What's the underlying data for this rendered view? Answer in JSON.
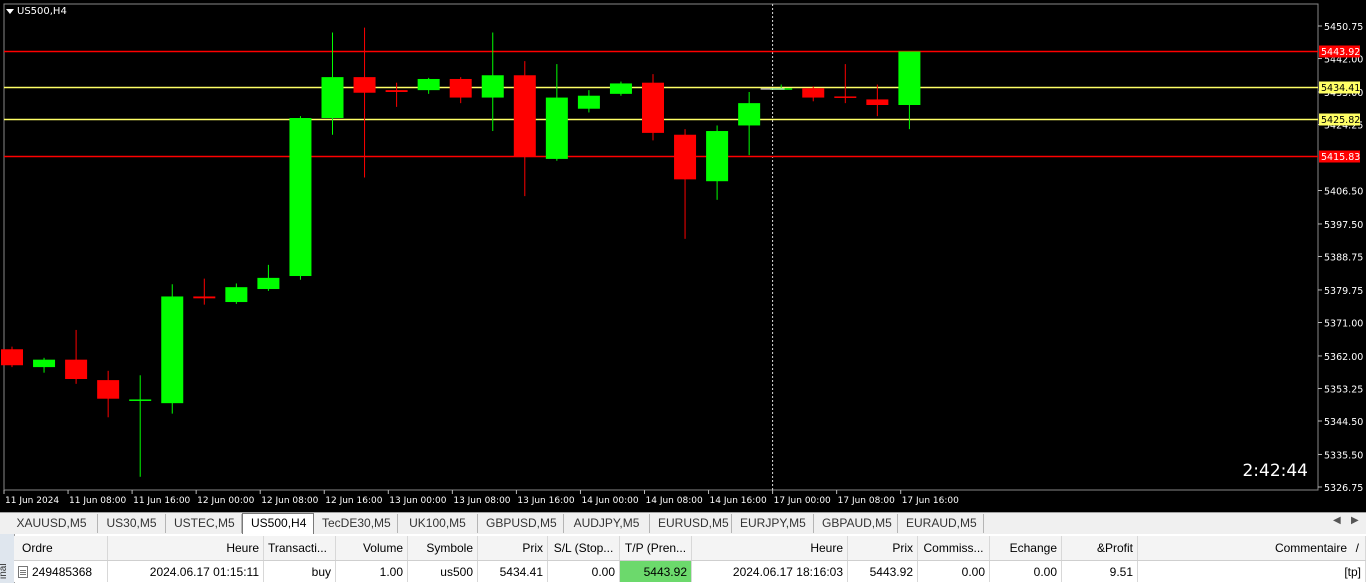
{
  "chart": {
    "symbol_label": "US500,H4",
    "countdown": "2:42:44",
    "colors": {
      "bg": "#000000",
      "bull": "#00ff00",
      "bear": "#ff0000",
      "wick_bull": "#00ff00",
      "wick_bear": "#ff0000",
      "red_line": "#ff0000",
      "yellow_line": "#ffff66"
    }
  },
  "chart_data": {
    "type": "candlestick",
    "y_ticks": [
      "5450.75",
      "5442.00",
      "5433.00",
      "5424.25",
      "5406.50",
      "5397.50",
      "5388.75",
      "5379.75",
      "5371.00",
      "5362.00",
      "5353.25",
      "5344.50",
      "5335.50",
      "5326.75"
    ],
    "x_ticks": [
      "11 Jun 2024",
      "11 Jun 08:00",
      "11 Jun 16:00",
      "12 Jun 00:00",
      "12 Jun 08:00",
      "12 Jun 16:00",
      "13 Jun 00:00",
      "13 Jun 08:00",
      "13 Jun 16:00",
      "14 Jun 00:00",
      "14 Jun 08:00",
      "14 Jun 16:00",
      "17 Jun 00:00",
      "17 Jun 08:00",
      "17 Jun 16:00"
    ],
    "price_lines": [
      {
        "price": 5443.92,
        "label": "5443.92",
        "color": "red"
      },
      {
        "price": 5434.41,
        "label": "5434.41",
        "color": "yellow"
      },
      {
        "price": 5425.82,
        "label": "5425.82",
        "color": "yellow"
      },
      {
        "price": 5415.83,
        "label": "5415.83",
        "color": "red"
      }
    ],
    "crosshair_label_index": 12,
    "candles": [
      {
        "o": 5363.8,
        "h": 5364.5,
        "l": 5359.0,
        "c": 5359.5
      },
      {
        "o": 5359.0,
        "h": 5361.5,
        "l": 5357.5,
        "c": 5361.0
      },
      {
        "o": 5361.0,
        "h": 5369.0,
        "l": 5354.5,
        "c": 5355.8
      },
      {
        "o": 5355.5,
        "h": 5358.0,
        "l": 5345.5,
        "c": 5350.5
      },
      {
        "o": 5350.3,
        "h": 5356.8,
        "l": 5329.5,
        "c": 5350.3
      },
      {
        "o": 5349.3,
        "h": 5381.3,
        "l": 5346.5,
        "c": 5378.0
      },
      {
        "o": 5378.0,
        "h": 5382.8,
        "l": 5375.8,
        "c": 5377.5
      },
      {
        "o": 5376.5,
        "h": 5381.5,
        "l": 5376.0,
        "c": 5380.5
      },
      {
        "o": 5380.0,
        "h": 5386.5,
        "l": 5379.5,
        "c": 5383.0
      },
      {
        "o": 5383.5,
        "h": 5426.5,
        "l": 5382.5,
        "c": 5426.0
      },
      {
        "o": 5426.0,
        "h": 5449.0,
        "l": 5421.5,
        "c": 5437.0
      },
      {
        "o": 5437.0,
        "h": 5450.3,
        "l": 5410.0,
        "c": 5432.8
      },
      {
        "o": 5433.5,
        "h": 5435.5,
        "l": 5429.0,
        "c": 5433.0
      },
      {
        "o": 5433.5,
        "h": 5436.8,
        "l": 5432.5,
        "c": 5436.5
      },
      {
        "o": 5436.5,
        "h": 5437.0,
        "l": 5430.0,
        "c": 5431.5
      },
      {
        "o": 5431.5,
        "h": 5449.0,
        "l": 5422.5,
        "c": 5437.5
      },
      {
        "o": 5437.5,
        "h": 5441.3,
        "l": 5405.0,
        "c": 5415.5
      },
      {
        "o": 5415.0,
        "h": 5440.5,
        "l": 5414.5,
        "c": 5431.5
      },
      {
        "o": 5428.5,
        "h": 5433.5,
        "l": 5427.5,
        "c": 5432.0
      },
      {
        "o": 5432.5,
        "h": 5435.8,
        "l": 5432.0,
        "c": 5435.3
      },
      {
        "o": 5435.5,
        "h": 5437.8,
        "l": 5420.0,
        "c": 5422.0
      },
      {
        "o": 5421.5,
        "h": 5423.0,
        "l": 5393.5,
        "c": 5409.5
      },
      {
        "o": 5409.0,
        "h": 5424.0,
        "l": 5404.0,
        "c": 5422.5
      },
      {
        "o": 5424.0,
        "h": 5433.0,
        "l": 5416.0,
        "c": 5430.0
      },
      {
        "o": 5434.0,
        "h": 5435.0,
        "l": 5434.0,
        "c": 5434.0
      },
      {
        "o": 5434.0,
        "h": 5434.5,
        "l": 5430.5,
        "c": 5431.5
      },
      {
        "o": 5431.8,
        "h": 5440.5,
        "l": 5430.0,
        "c": 5431.5
      },
      {
        "o": 5431.0,
        "h": 5435.0,
        "l": 5426.5,
        "c": 5429.5
      },
      {
        "o": 5429.5,
        "h": 5443.9,
        "l": 5423.0,
        "c": 5443.9
      }
    ]
  },
  "tabs": {
    "items": [
      "XAUUSD,M5",
      "US30,M5",
      "USTEC,M5",
      "US500,H4",
      "TecDE30,M5",
      "UK100,M5",
      "GBPUSD,M5",
      "AUDJPY,M5",
      "EURUSD,M5",
      "EURJPY,M5",
      "GBPAUD,M5",
      "EURAUD,M5"
    ],
    "active": "US500,H4",
    "arrow_left": "◀",
    "arrow_right": "▶"
  },
  "terminal": {
    "side_label": "inal",
    "columns": [
      "Ordre",
      "Heure",
      "Transacti...",
      "Volume",
      "Symbole",
      "Prix",
      "S/L (Stop...",
      "T/P (Pren...",
      "Heure",
      "Prix",
      "Commiss...",
      "Echange",
      "&Profit",
      "Commentaire"
    ],
    "sort_marker": "/",
    "rows": [
      [
        "249485368",
        "2024.06.17 01:15:11",
        "buy",
        "1.00",
        "us500",
        "5434.41",
        "0.00",
        "5443.92",
        "2024.06.17 18:16:03",
        "5443.92",
        "0.00",
        "0.00",
        "9.51",
        "[tp]"
      ]
    ]
  }
}
